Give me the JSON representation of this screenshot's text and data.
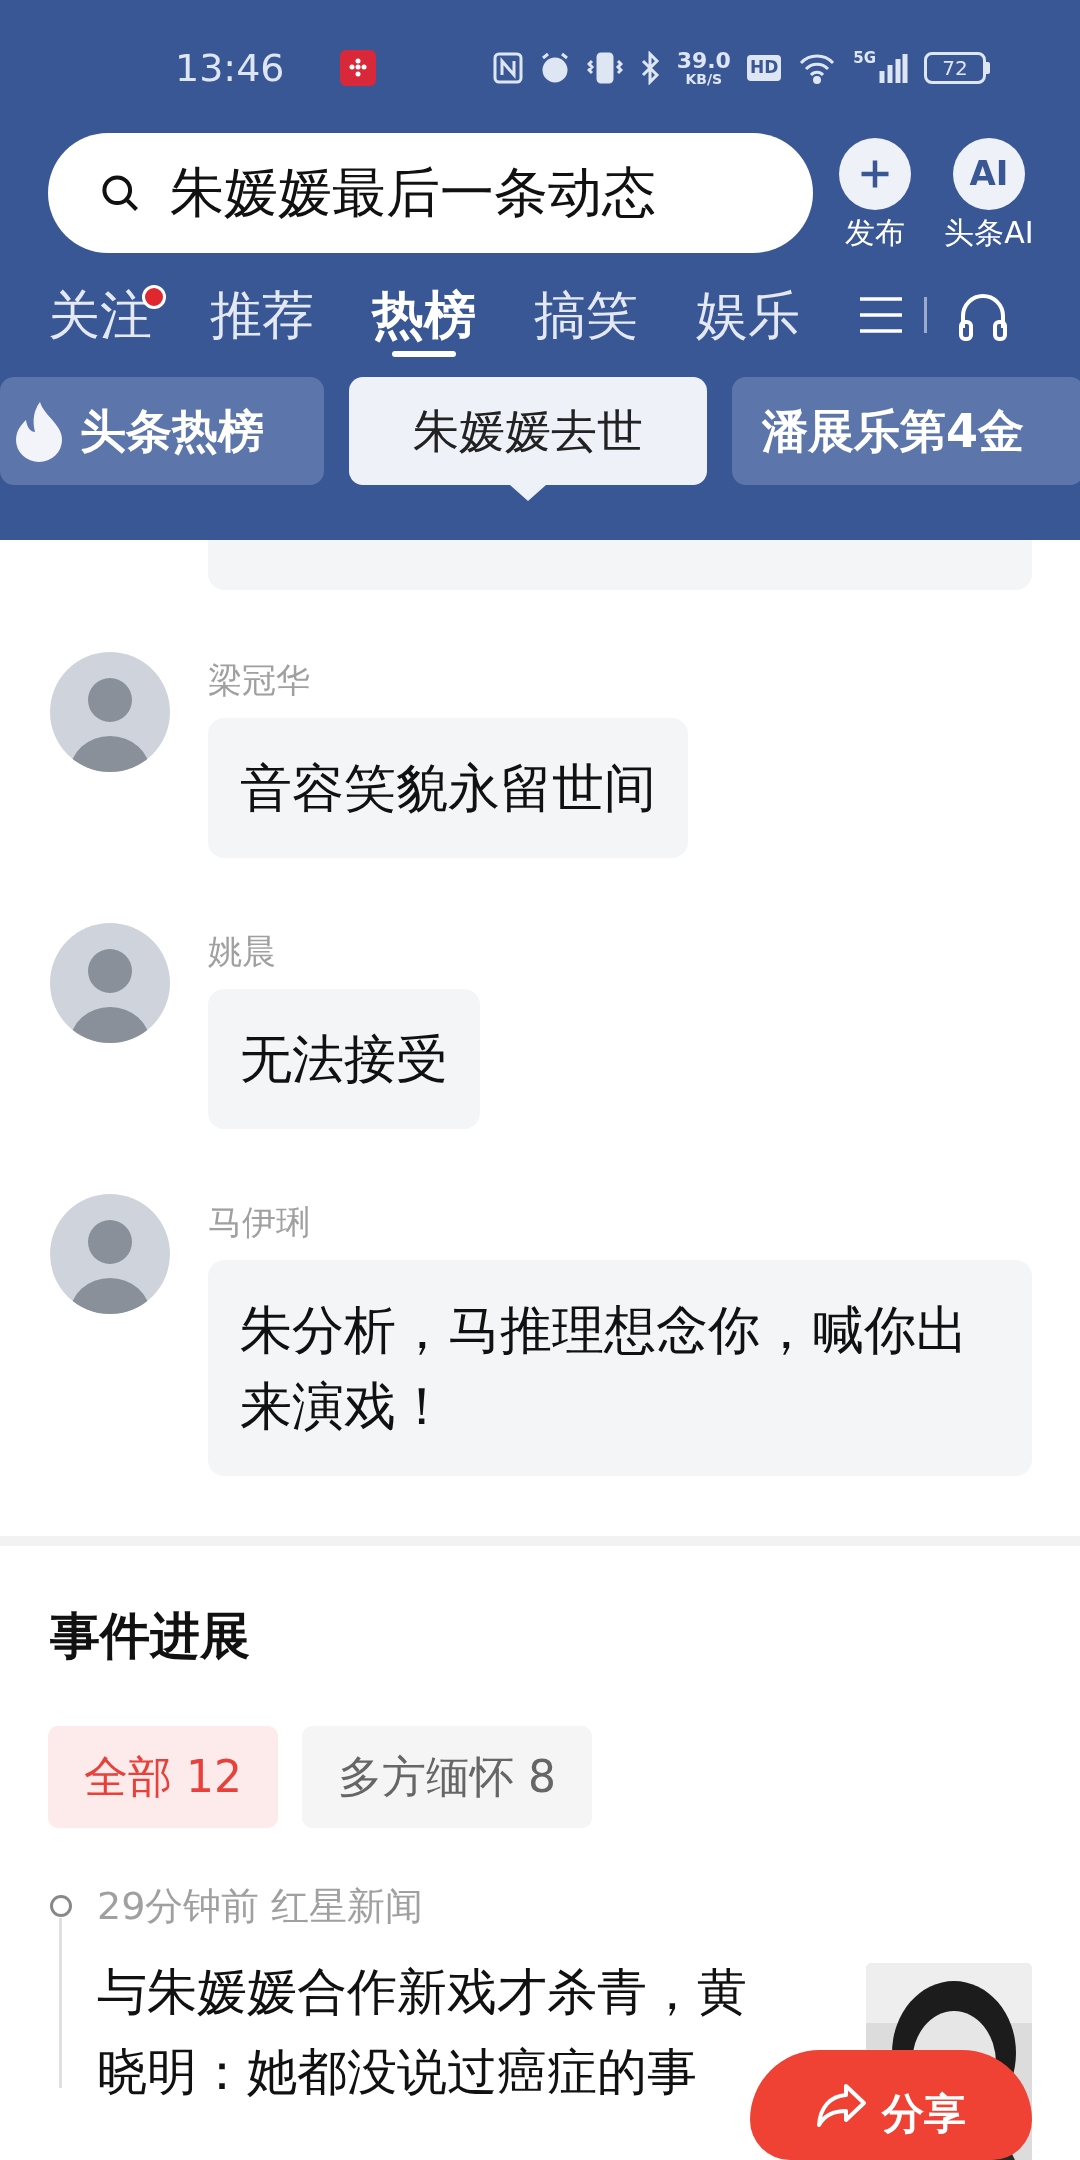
{
  "status_bar": {
    "time": "13:46",
    "speed": "39.0",
    "speed_unit": "KB/S",
    "hd": "HD",
    "network": "5G",
    "battery": "72"
  },
  "search": {
    "placeholder": "朱媛媛最后一条动态"
  },
  "header_actions": [
    {
      "kind": "plus",
      "label": "发布"
    },
    {
      "kind": "ai",
      "icon_text": "AI",
      "label": "头条AI"
    }
  ],
  "tabs": [
    {
      "label": "关注",
      "selected": false,
      "badge": true
    },
    {
      "label": "推荐",
      "selected": false,
      "badge": false
    },
    {
      "label": "热榜",
      "selected": true,
      "badge": false
    },
    {
      "label": "搞笑",
      "selected": false,
      "badge": false
    },
    {
      "label": "娱乐",
      "selected": false,
      "badge": false
    }
  ],
  "topics": [
    {
      "kind": "brand",
      "label": "头条热榜",
      "selected": false
    },
    {
      "kind": "topic",
      "label": "朱媛媛去世",
      "selected": true
    },
    {
      "kind": "topic",
      "label": "潘展乐第4金",
      "selected": false
    }
  ],
  "comments": [
    {
      "name": "梁冠华",
      "text": "音容笑貌永留世间"
    },
    {
      "name": "姚晨",
      "text": "无法接受"
    },
    {
      "name": "马伊琍",
      "text": "朱分析，马推理想念你，喊你出来演戏！"
    }
  ],
  "section": {
    "title": "事件进展",
    "filters": [
      {
        "label": "全部 12",
        "selected": true
      },
      {
        "label": "多方缅怀 8",
        "selected": false
      }
    ]
  },
  "timeline": [
    {
      "meta": "29分钟前 红星新闻",
      "headline": "与朱媛媛合作新戏才杀青，黄晓明：她都没说过癌症的事"
    }
  ],
  "share_button": {
    "label": "分享"
  }
}
